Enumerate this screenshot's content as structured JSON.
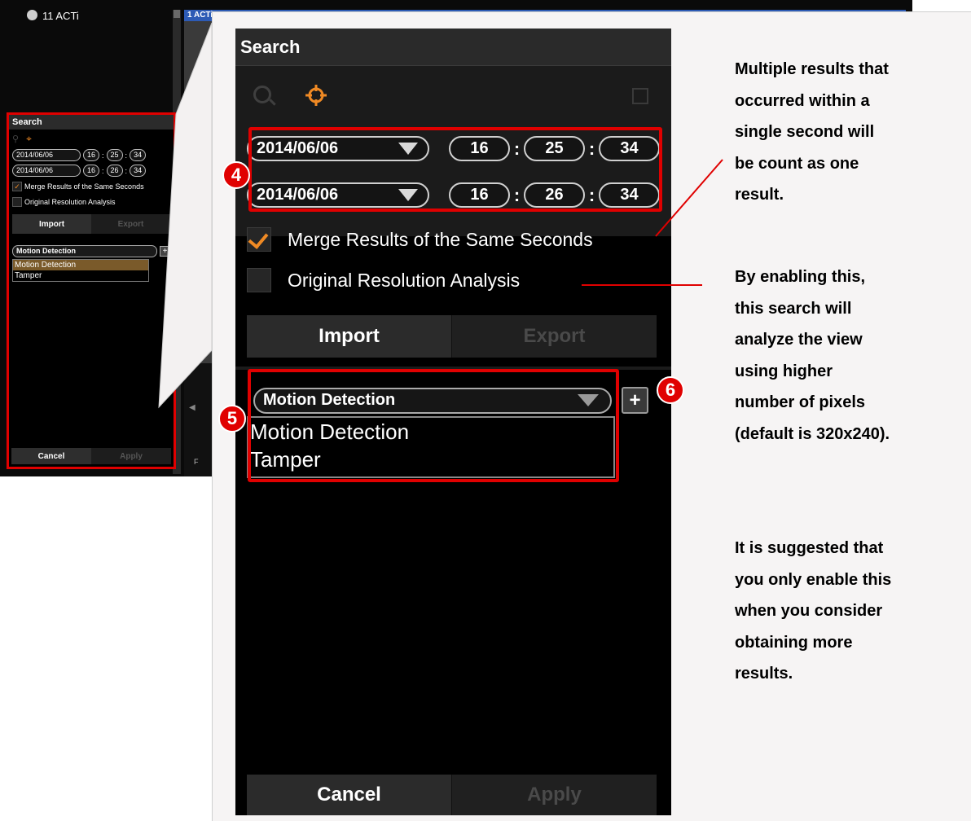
{
  "background": {
    "camera_label": "11 ACTi",
    "view_title": "1 ACTi"
  },
  "search_panel": {
    "title": "Search",
    "start": {
      "date": "2014/06/06",
      "hour": "16",
      "minute": "25",
      "second": "34"
    },
    "end": {
      "date": "2014/06/06",
      "hour": "16",
      "minute": "26",
      "second": "34"
    },
    "merge_label": "Merge Results of the Same Seconds",
    "merge_checked": true,
    "original_label": "Original Resolution Analysis",
    "original_checked": false,
    "import_label": "Import",
    "export_label": "Export",
    "analysis_selected": "Motion Detection",
    "analysis_options": [
      "Motion Detection",
      "Tamper"
    ],
    "plus_label": "+",
    "cancel_label": "Cancel",
    "apply_label": "Apply"
  },
  "badges": {
    "b4": "4",
    "b5": "5",
    "b6": "6"
  },
  "notes": {
    "merge": [
      "Multiple results that",
      "occurred within a",
      "single second will",
      "be count as one",
      "result."
    ],
    "original": [
      "By enabling this,",
      "this search will",
      "analyze the view",
      "using higher",
      "number of pixels",
      "(default is 320x240)."
    ],
    "suggest": [
      "It is suggested that",
      "you only enable this",
      "when you consider",
      "obtaining more",
      "results."
    ]
  },
  "colors": {
    "highlight": "#e00000",
    "accent_orange": "#f08a24",
    "panel_bg": "#000000"
  },
  "icons": [
    "search-icon",
    "target-icon",
    "popout-icon",
    "checkmark-icon",
    "dropdown-arrow-icon",
    "plus-icon",
    "camera-icon"
  ]
}
